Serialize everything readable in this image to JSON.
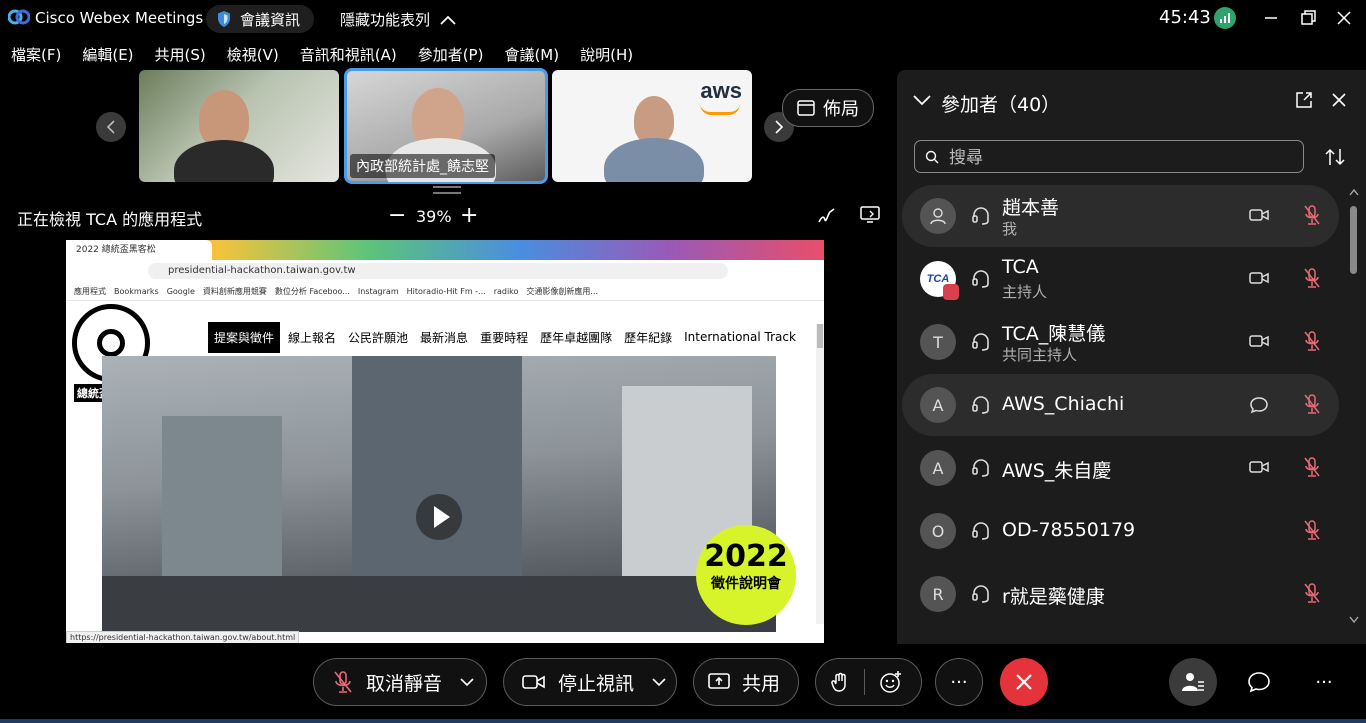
{
  "app": {
    "title": "Cisco Webex Meetings",
    "meeting_info": "會議資訊",
    "hide_menu": "隱藏功能表列",
    "timer": "45:43"
  },
  "menu": [
    "檔案(F)",
    "編輯(E)",
    "共用(S)",
    "檢視(V)",
    "音訊和視訊(A)",
    "參加者(P)",
    "會議(M)",
    "說明(H)"
  ],
  "video_strip": {
    "thumb2_name": "內政部統計處_饒志堅",
    "aws_logo": "aws",
    "layout_label": "佈局"
  },
  "share": {
    "label": "正在檢視 TCA 的應用程式",
    "zoom": "39%",
    "minus": "−",
    "plus": "+"
  },
  "browser": {
    "tab": "2022 總統盃黑客松",
    "url": "presidential-hackathon.taiwan.gov.tw",
    "bookmarks": [
      "應用程式",
      "Bookmarks",
      "Google",
      "資料創新應用競賽",
      "數位分析 Faceboo...",
      "Instagram",
      "Hitoradio-Hit Fm -...",
      "radiko",
      "交通影像創新應用..."
    ],
    "logo_text": "總統盃黑客松",
    "nav": [
      "提案與徵件",
      "線上報名",
      "公民許願池",
      "最新消息",
      "重要時程",
      "歷年卓越團隊",
      "歷年紀錄",
      "International Track"
    ],
    "badge_year": "2022",
    "badge_text": "徵件說明會",
    "status_url": "https://presidential-hackathon.taiwan.gov.tw/about.html"
  },
  "participants": {
    "title": "參加者（40）",
    "search_placeholder": "搜尋",
    "list": [
      {
        "name": "趙本善",
        "role": "我",
        "avatar": "",
        "video": true
      },
      {
        "name": "TCA",
        "role": "主持人",
        "avatar": "TCA",
        "video": true
      },
      {
        "name": "TCA_陳慧儀",
        "role": "共同主持人",
        "avatar": "T",
        "video": true
      },
      {
        "name": "AWS_Chiachi",
        "role": "",
        "avatar": "A",
        "video": false
      },
      {
        "name": "AWS_朱自慶",
        "role": "",
        "avatar": "A",
        "video": true
      },
      {
        "name": "OD-78550179",
        "role": "",
        "avatar": "O",
        "video": false
      },
      {
        "name": "r就是藥健康",
        "role": "",
        "avatar": "R",
        "video": false
      }
    ]
  },
  "controls": {
    "unmute": "取消靜音",
    "stop_video": "停止視訊",
    "share": "共用",
    "more": "···"
  },
  "colors": {
    "leave": "#e5333b",
    "mute_red": "#e86a75",
    "active_outline": "#4a9be8",
    "badge": "#d7f42a"
  }
}
